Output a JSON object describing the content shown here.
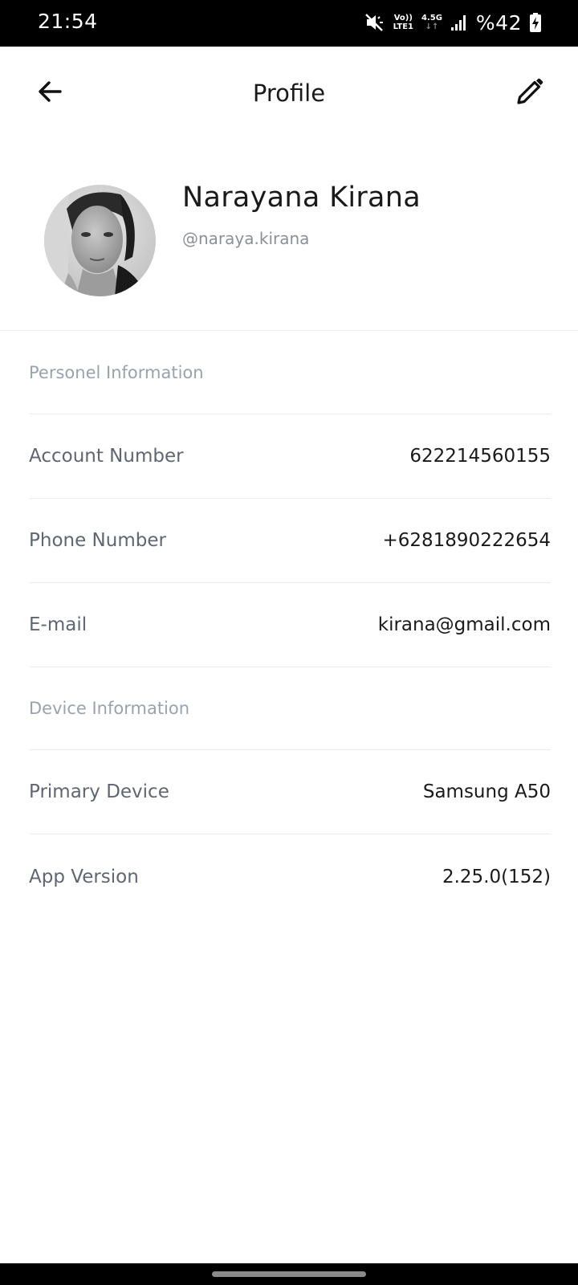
{
  "status_bar": {
    "time": "21:54",
    "volte_top": "Vo))",
    "volte_bottom": "LTE1",
    "network_type": "4.5G",
    "network_arrows": "↓↑",
    "battery": "%42"
  },
  "app_bar": {
    "title": "Profile",
    "back_icon": "arrow-left-icon",
    "edit_icon": "pencil-icon"
  },
  "profile": {
    "name": "Narayana Kirana",
    "username": "@naraya.kirana"
  },
  "sections": {
    "personal": {
      "title": "Personel Information",
      "rows": [
        {
          "label": "Account Number",
          "value": "622214560155"
        },
        {
          "label": "Phone Number",
          "value": "+6281890222654"
        },
        {
          "label": "E-mail",
          "value": "kirana@gmail.com"
        }
      ]
    },
    "device": {
      "title": "Device Information",
      "rows": [
        {
          "label": "Primary Device",
          "value": "Samsung A50"
        },
        {
          "label": "App Version",
          "value": "2.25.0(152)"
        }
      ]
    }
  },
  "colors": {
    "label": "#5f6673",
    "section_header": "#9aa2ad",
    "divider": "#ececec"
  }
}
